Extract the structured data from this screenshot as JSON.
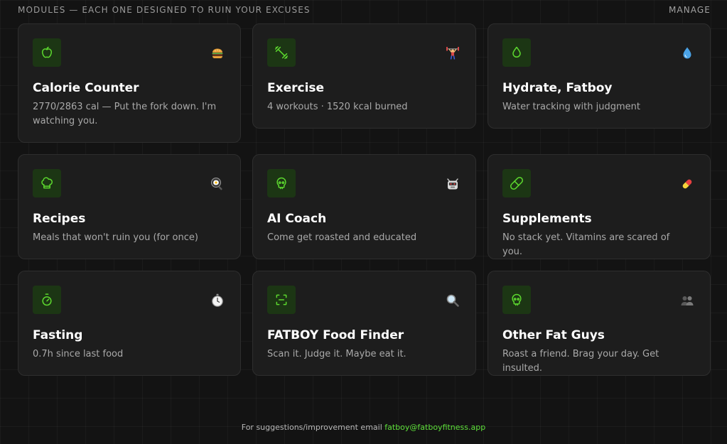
{
  "header": {
    "title": "MODULES — EACH ONE DESIGNED TO RUIN YOUR EXCUSES",
    "manage": "MANAGE"
  },
  "modules": [
    {
      "title": "Calorie Counter",
      "desc": "2770/2863 cal — Put the fork down. I'm watching you.",
      "icon": "apple-icon",
      "emoji": "burger-emoji"
    },
    {
      "title": "Exercise",
      "desc": "4 workouts · 1520 kcal burned",
      "icon": "dumbbell-icon",
      "emoji": "weightlifter-emoji"
    },
    {
      "title": "Hydrate, Fatboy",
      "desc": "Water tracking with judgment",
      "icon": "droplet-icon",
      "emoji": "water-drop-emoji"
    },
    {
      "title": "Recipes",
      "desc": "Meals that won't ruin you (for once)",
      "icon": "chef-hat-icon",
      "emoji": "frying-pan-emoji"
    },
    {
      "title": "AI Coach",
      "desc": "Come get roasted and educated",
      "icon": "skull-icon",
      "emoji": "robot-emoji"
    },
    {
      "title": "Supplements",
      "desc": "No stack yet. Vitamins are scared of you.",
      "icon": "pill-icon",
      "emoji": "pill-emoji"
    },
    {
      "title": "Fasting",
      "desc": "0.7h since last food",
      "icon": "timer-icon",
      "emoji": "stopwatch-emoji"
    },
    {
      "title": "FATBOY Food Finder",
      "desc": "Scan it. Judge it. Maybe eat it.",
      "icon": "scan-icon",
      "emoji": "magnifier-emoji"
    },
    {
      "title": "Other Fat Guys",
      "desc": "Roast a friend. Brag your day. Get insulted.",
      "icon": "skull-icon",
      "emoji": "people-emoji"
    }
  ],
  "footer": {
    "text": "For suggestions/improvement email ",
    "email": "fatboy@fatboyfitness.app"
  },
  "colors": {
    "accent": "#5cd82e",
    "icon_bg": "#1c3614",
    "card_bg": "#1d1d1d",
    "page_bg": "#131313"
  }
}
